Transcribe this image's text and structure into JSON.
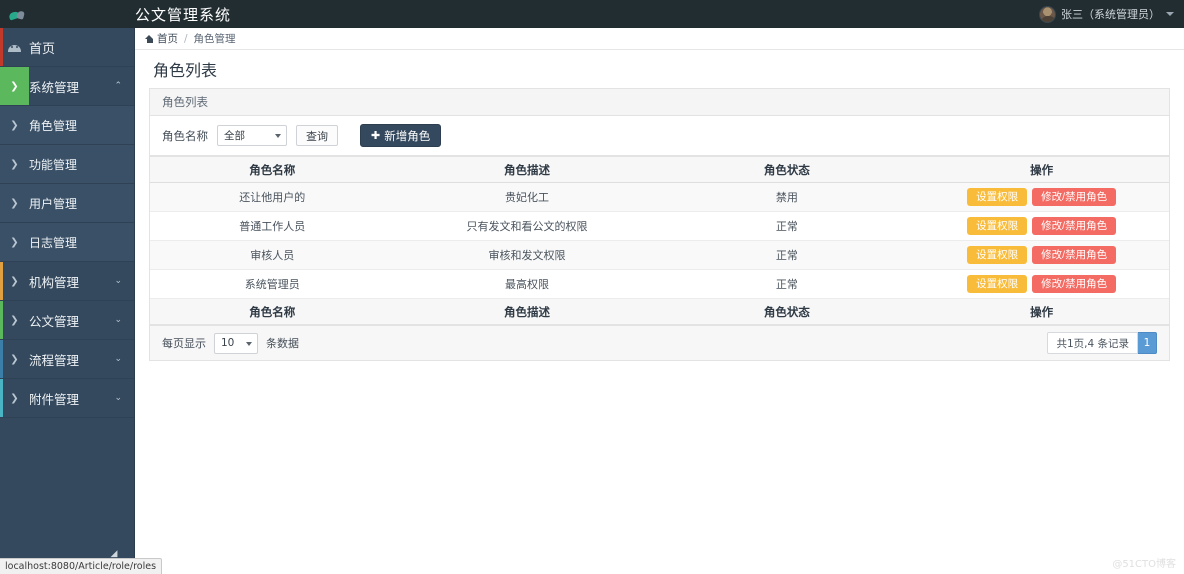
{
  "header": {
    "app_title": "公文管理系统",
    "logo_icon": "cloud-logo-icon",
    "user_name": "张三（系统管理员）",
    "caret_icon": "chevron-down-icon"
  },
  "sidebar": {
    "items": [
      {
        "label": "首页",
        "icon": "dashboard-icon",
        "accent": "#c0392b",
        "chevron": "",
        "state": "home"
      },
      {
        "label": "系统管理",
        "icon": "chevron-right-icon",
        "accent": "#5cb85c",
        "chevron": "⌃",
        "state": "active-green"
      },
      {
        "label": "角色管理",
        "icon": "chevron-right-icon",
        "accent": "",
        "chevron": "",
        "state": "sub"
      },
      {
        "label": "功能管理",
        "icon": "chevron-right-icon",
        "accent": "",
        "chevron": "",
        "state": "sub"
      },
      {
        "label": "用户管理",
        "icon": "chevron-right-icon",
        "accent": "",
        "chevron": "",
        "state": "sub"
      },
      {
        "label": "日志管理",
        "icon": "chevron-right-icon",
        "accent": "",
        "chevron": "",
        "state": "sub"
      },
      {
        "label": "机构管理",
        "icon": "chevron-right-icon",
        "accent": "#e0a042",
        "chevron": "⌄",
        "state": ""
      },
      {
        "label": "公文管理",
        "icon": "chevron-right-icon",
        "accent": "#5cb85c",
        "chevron": "⌄",
        "state": ""
      },
      {
        "label": "流程管理",
        "icon": "chevron-right-icon",
        "accent": "#3b7ea8",
        "chevron": "⌄",
        "state": ""
      },
      {
        "label": "附件管理",
        "icon": "chevron-right-icon",
        "accent": "#4ab3c4",
        "chevron": "⌄",
        "state": ""
      }
    ]
  },
  "breadcrumb": {
    "home_icon": "home-icon",
    "home_label": "首页",
    "separator": "/",
    "current": "角色管理"
  },
  "page": {
    "title": "角色列表",
    "panel_heading": "角色列表"
  },
  "filter": {
    "label": "角色名称",
    "select_value": "全部",
    "query_button": "查询",
    "add_button": "新增角色",
    "add_icon": "plus-icon"
  },
  "table": {
    "columns": [
      "角色名称",
      "角色描述",
      "角色状态",
      "操作"
    ],
    "rows": [
      {
        "name": "还让他用户的",
        "desc": "贵妃化工",
        "status": "禁用",
        "actions": [
          "设置权限",
          "修改/禁用角色"
        ]
      },
      {
        "name": "普通工作人员",
        "desc": "只有发文和看公文的权限",
        "status": "正常",
        "actions": [
          "设置权限",
          "修改/禁用角色"
        ]
      },
      {
        "name": "审核人员",
        "desc": "审核和发文权限",
        "status": "正常",
        "actions": [
          "设置权限",
          "修改/禁用角色"
        ]
      },
      {
        "name": "系统管理员",
        "desc": "最高权限",
        "status": "正常",
        "actions": [
          "设置权限",
          "修改/禁用角色"
        ]
      }
    ]
  },
  "footer": {
    "per_page_prefix": "每页显示",
    "per_page_value": "10",
    "per_page_suffix": "条数据",
    "page_info": "共1页,4 条记录",
    "current_page": "1"
  },
  "statusbar": {
    "url": "localhost:8080/Article/role/roles"
  },
  "watermark": "@51CTO博客",
  "colors": {
    "topbar": "#222d32",
    "sidebar": "#34495e",
    "accent_green": "#5cb85c",
    "btn_permission": "#f9bc3a",
    "btn_edit": "#f36b62",
    "page_active": "#5b9bd5",
    "add_button": "#34495e"
  }
}
